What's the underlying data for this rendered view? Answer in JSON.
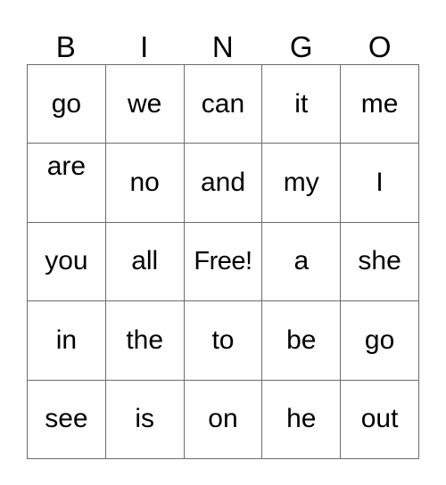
{
  "card": {
    "title": "BINGO",
    "header_letters": [
      "B",
      "I",
      "N",
      "G",
      "O"
    ],
    "free_space_label": "Free!",
    "free_space_position": {
      "row": 3,
      "column": 3
    },
    "grid_size": "5x5",
    "colors": {
      "background": "#ffffff",
      "cell_background": "#ffffff",
      "border": "#6b6b6b",
      "text": "#000000"
    },
    "rows": [
      {
        "cells": [
          {
            "text": "go",
            "free": false,
            "align": "center"
          },
          {
            "text": "we",
            "free": false,
            "align": "center"
          },
          {
            "text": "can",
            "free": false,
            "align": "center"
          },
          {
            "text": "it",
            "free": false,
            "align": "center"
          },
          {
            "text": "me",
            "free": false,
            "align": "center"
          }
        ]
      },
      {
        "cells": [
          {
            "text": "are",
            "free": false,
            "align": "top"
          },
          {
            "text": "no",
            "free": false,
            "align": "center"
          },
          {
            "text": "and",
            "free": false,
            "align": "center"
          },
          {
            "text": "my",
            "free": false,
            "align": "center"
          },
          {
            "text": "I",
            "free": false,
            "align": "center"
          }
        ]
      },
      {
        "cells": [
          {
            "text": "you",
            "free": false,
            "align": "center"
          },
          {
            "text": "all",
            "free": false,
            "align": "center"
          },
          {
            "text": "Free!",
            "free": true,
            "align": "center"
          },
          {
            "text": "a",
            "free": false,
            "align": "center"
          },
          {
            "text": "she",
            "free": false,
            "align": "center"
          }
        ]
      },
      {
        "cells": [
          {
            "text": "in",
            "free": false,
            "align": "center"
          },
          {
            "text": "the",
            "free": false,
            "align": "center"
          },
          {
            "text": "to",
            "free": false,
            "align": "center"
          },
          {
            "text": "be",
            "free": false,
            "align": "center"
          },
          {
            "text": "go",
            "free": false,
            "align": "center"
          }
        ]
      },
      {
        "cells": [
          {
            "text": "see",
            "free": false,
            "align": "center"
          },
          {
            "text": "is",
            "free": false,
            "align": "center"
          },
          {
            "text": "on",
            "free": false,
            "align": "center"
          },
          {
            "text": "he",
            "free": false,
            "align": "center"
          },
          {
            "text": "out",
            "free": false,
            "align": "center"
          }
        ]
      }
    ]
  }
}
